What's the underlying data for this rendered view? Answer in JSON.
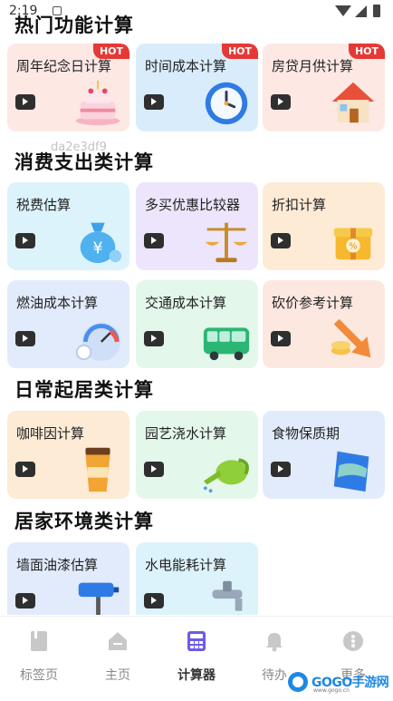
{
  "status_bar": {
    "time": "2:19"
  },
  "sections": [
    {
      "title": "热门功能计算",
      "cards": [
        {
          "label": "周年纪念日计算",
          "hot": "HOT",
          "icon": "cake-icon",
          "bg": "#fde8e4"
        },
        {
          "label": "时间成本计算",
          "hot": "HOT",
          "icon": "clock-icon",
          "bg": "#d9ecfb"
        },
        {
          "label": "房贷月供计算",
          "hot": "HOT",
          "icon": "house-icon",
          "bg": "#fde8e4"
        }
      ]
    },
    {
      "title": "消费支出类计算",
      "cards": [
        {
          "label": "税费估算",
          "icon": "money-bag-icon",
          "bg": "#dcf3fb"
        },
        {
          "label": "多买优惠比较器",
          "icon": "scale-icon",
          "bg": "#ece5fb"
        },
        {
          "label": "折扣计算",
          "icon": "discount-gift-icon",
          "bg": "#fdebd5"
        },
        {
          "label": "燃油成本计算",
          "icon": "fuel-gauge-icon",
          "bg": "#e1ebfb"
        },
        {
          "label": "交通成本计算",
          "icon": "bus-icon",
          "bg": "#e3f7ea"
        },
        {
          "label": "砍价参考计算",
          "icon": "coins-arrow-icon",
          "bg": "#fde8e0"
        }
      ]
    },
    {
      "title": "日常起居类计算",
      "cards": [
        {
          "label": "咖啡因计算",
          "icon": "coffee-cup-icon",
          "bg": "#fdebd5"
        },
        {
          "label": "园艺浇水计算",
          "icon": "watering-can-icon",
          "bg": "#e3f7ea"
        },
        {
          "label": "食物保质期",
          "icon": "food-bag-icon",
          "bg": "#e1ebfb"
        }
      ]
    },
    {
      "title": "居家环境类计算",
      "cards": [
        {
          "label": "墙面油漆估算",
          "icon": "paint-roller-icon",
          "bg": "#e1ebfb"
        },
        {
          "label": "水电能耗计算",
          "icon": "faucet-icon",
          "bg": "#dcf3fb"
        }
      ]
    }
  ],
  "watermark": "da2e3df9",
  "tabbar": [
    {
      "label": "标签页",
      "icon": "bookmark-icon",
      "active": false
    },
    {
      "label": "主页",
      "icon": "home-icon",
      "active": false
    },
    {
      "label": "计算器",
      "icon": "calculator-icon",
      "active": true
    },
    {
      "label": "待办",
      "icon": "bell-icon",
      "active": false
    },
    {
      "label": "更多",
      "icon": "more-icon",
      "active": false
    }
  ],
  "brand_watermark": {
    "text": "GOGO手游网",
    "sub": "www.gogo.cn"
  },
  "colors": {
    "active_tab": "#6c5ce7",
    "hot_badge": "#e53935",
    "go_button": "#2f2f2f"
  }
}
